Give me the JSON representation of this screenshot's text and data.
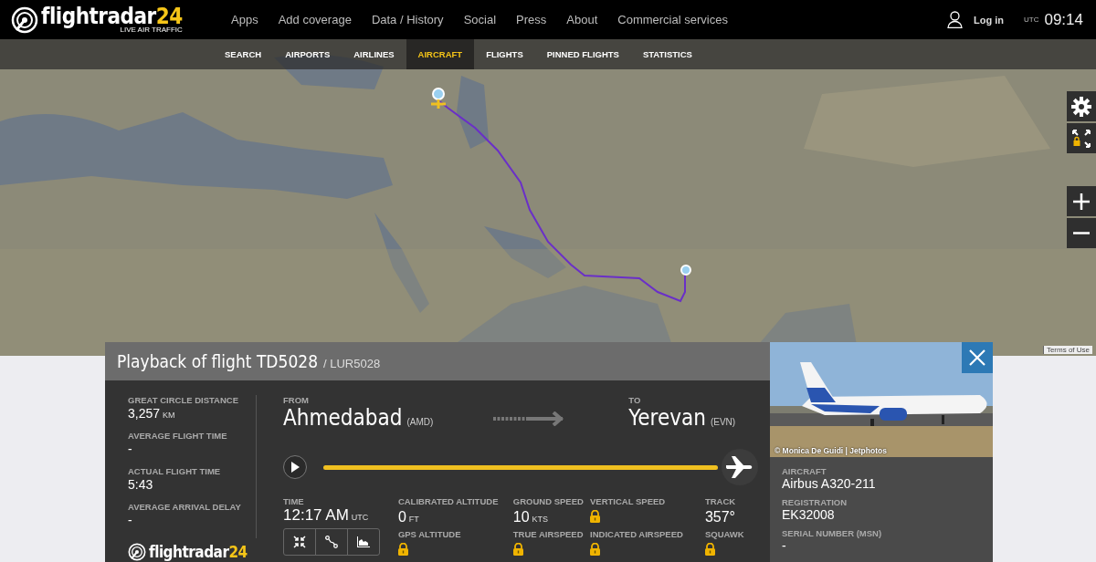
{
  "header": {
    "logo": {
      "name": "flightradar",
      "suffix": "24",
      "tagline": "LIVE AIR TRAFFIC"
    },
    "menu": [
      "Apps",
      "Add coverage",
      "Data / History",
      "Social",
      "Press",
      "About",
      "Commercial services"
    ],
    "login": "Log in",
    "utc_label": "UTC",
    "time": "09:14"
  },
  "subnav": [
    {
      "label": "SEARCH",
      "selected": false
    },
    {
      "label": "AIRPORTS",
      "selected": false
    },
    {
      "label": "AIRLINES",
      "selected": false
    },
    {
      "label": "AIRCRAFT",
      "selected": true
    },
    {
      "label": "FLIGHTS",
      "selected": false
    },
    {
      "label": "PINNED FLIGHTS",
      "selected": false
    },
    {
      "label": "STATISTICS",
      "selected": false
    }
  ],
  "map": {
    "terms": "Terms of Use"
  },
  "flight": {
    "title": "Playback of flight TD5028",
    "callsign": "/ LUR5028",
    "stats": [
      {
        "label": "GREAT CIRCLE DISTANCE",
        "value": "3,257",
        "unit": "KM"
      },
      {
        "label": "AVERAGE FLIGHT TIME",
        "value": "-"
      },
      {
        "label": "ACTUAL FLIGHT TIME",
        "value": "5:43"
      },
      {
        "label": "AVERAGE ARRIVAL DELAY",
        "value": "-"
      }
    ],
    "footer_logo": {
      "name": "flightradar",
      "suffix": "24"
    },
    "from": {
      "label": "FROM",
      "city": "Ahmedabad",
      "code": "(AMD)"
    },
    "to": {
      "label": "TO",
      "city": "Yerevan",
      "code": "(EVN)"
    },
    "progress": {
      "level": 1
    },
    "time": {
      "label": "TIME",
      "value": "12:17 AM",
      "unit": "UTC"
    },
    "readings": [
      [
        {
          "label": "CALIBRATED ALTITUDE",
          "value": "0",
          "unit": "FT",
          "locked": false
        },
        {
          "label": "GPS ALTITUDE",
          "locked": true
        }
      ],
      [
        {
          "label": "GROUND SPEED",
          "value": "10",
          "unit": "KTS",
          "locked": false
        },
        {
          "label": "TRUE AIRSPEED",
          "locked": true
        }
      ],
      [
        {
          "label": "VERTICAL SPEED",
          "locked": true
        },
        {
          "label": "INDICATED AIRSPEED",
          "locked": true
        }
      ],
      [
        {
          "label": "TRACK",
          "value": "357°",
          "locked": false
        },
        {
          "label": "SQUAWK",
          "locked": true
        }
      ]
    ]
  },
  "aircraft": {
    "photo_credit": "© Monica De Guidi | Jetphotos",
    "fields": [
      {
        "label": "AIRCRAFT",
        "value": "Airbus A320-211"
      },
      {
        "label": "REGISTRATION",
        "value": "EK32008"
      },
      {
        "label": "SERIAL NUMBER (MSN)",
        "value": "-"
      }
    ]
  }
}
